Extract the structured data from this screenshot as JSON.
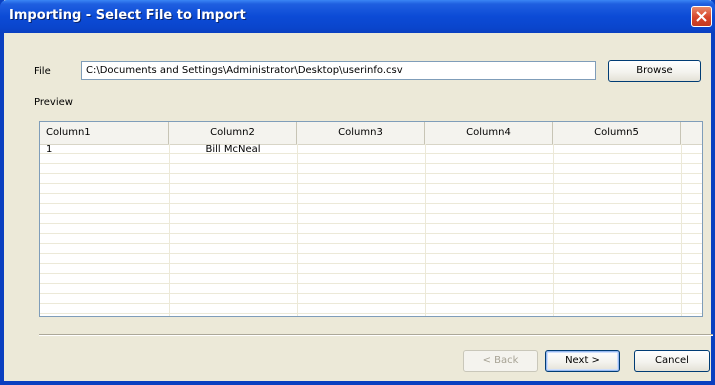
{
  "window": {
    "title": "Importing - Select File to Import"
  },
  "file": {
    "label": "File",
    "value": "C:\\Documents and Settings\\Administrator\\Desktop\\userinfo.csv",
    "browse_label": "Browse"
  },
  "preview": {
    "label": "Preview",
    "columns": [
      "Column1",
      "Column2",
      "Column3",
      "Column4",
      "Column5"
    ],
    "rows": [
      [
        "1",
        "Bill McNeal",
        "",
        "",
        ""
      ]
    ]
  },
  "footer": {
    "back_label": "< Back",
    "next_label": "Next >",
    "cancel_label": "Cancel"
  },
  "colors": {
    "titlebar": "#0a45cc",
    "dialog_bg": "#ece9d8",
    "close_button": "#d7452a"
  },
  "icons": {
    "close": "close-icon"
  }
}
